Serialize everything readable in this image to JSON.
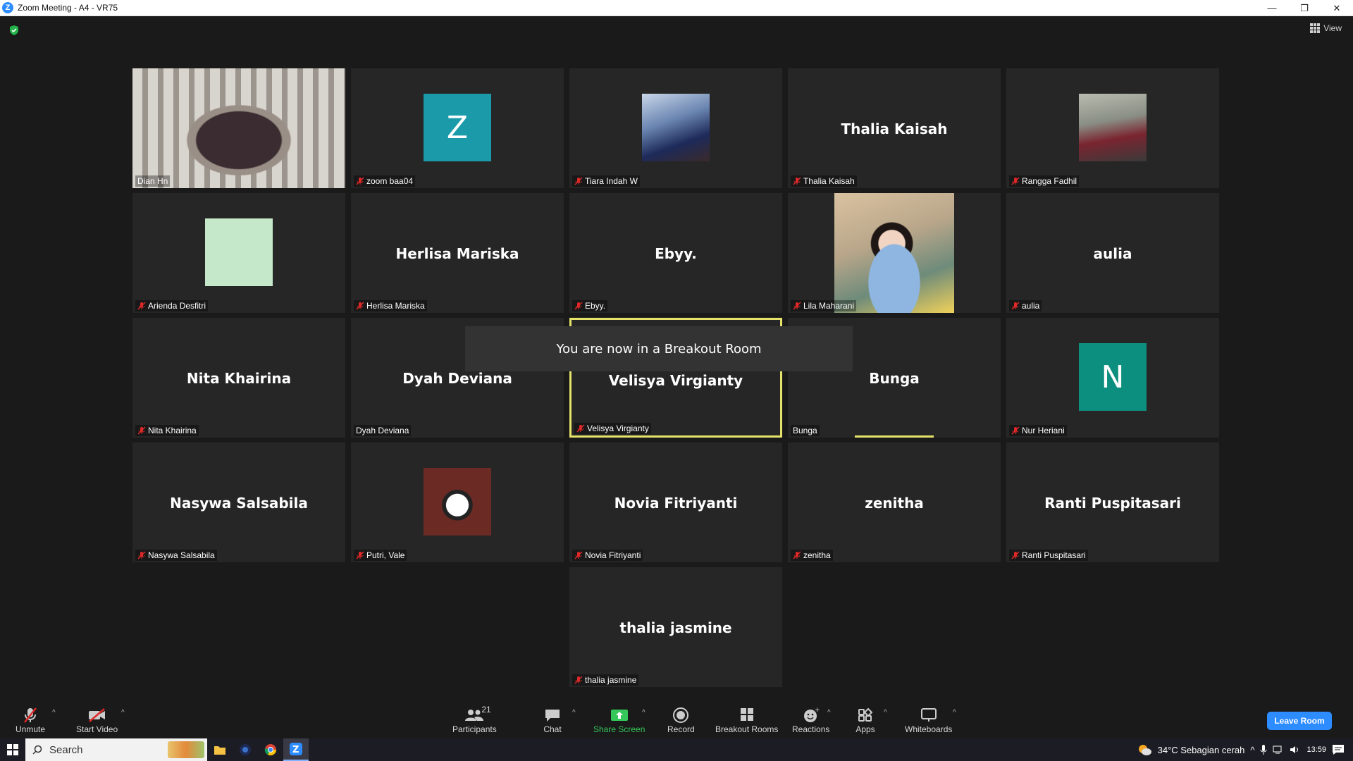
{
  "window": {
    "title": "Zoom Meeting - A4 - VR75"
  },
  "header": {
    "view_label": "View"
  },
  "participants_tiles": [
    {
      "name": "Dian Hn",
      "big": "",
      "muted": false,
      "kind": "video"
    },
    {
      "name": "zoom baa04",
      "big": "",
      "muted": true,
      "kind": "letter",
      "letter": "Z",
      "color": "#1b9aaa"
    },
    {
      "name": "Tiara Indah W",
      "big": "",
      "muted": true,
      "kind": "photo"
    },
    {
      "name": "Thalia Kaisah",
      "big": "Thalia Kaisah",
      "muted": true,
      "kind": "name"
    },
    {
      "name": "Rangga Fadhil",
      "big": "",
      "muted": true,
      "kind": "photo"
    },
    {
      "name": "Arienda Desfitri",
      "big": "",
      "muted": true,
      "kind": "solid",
      "color": "#c4e8c9"
    },
    {
      "name": "Herlisa Mariska",
      "big": "Herlisa Mariska",
      "muted": true,
      "kind": "name"
    },
    {
      "name": "Ebyy.",
      "big": "Ebyy.",
      "muted": true,
      "kind": "name"
    },
    {
      "name": "Lila Maharani",
      "big": "",
      "muted": true,
      "kind": "video"
    },
    {
      "name": "aulia",
      "big": "aulia",
      "muted": true,
      "kind": "name"
    },
    {
      "name": "Nita Khairina",
      "big": "Nita Khairina",
      "muted": true,
      "kind": "name"
    },
    {
      "name": "Dyah Deviana",
      "big": "Dyah Deviana",
      "muted": false,
      "kind": "name"
    },
    {
      "name": "Velisya Virgianty",
      "big": "Velisya Virgianty",
      "muted": true,
      "kind": "name"
    },
    {
      "name": "Bunga",
      "big": "Bunga",
      "muted": false,
      "kind": "name"
    },
    {
      "name": "Nur Heriani",
      "big": "",
      "muted": true,
      "kind": "letter",
      "letter": "N",
      "color": "#0d8f7f"
    },
    {
      "name": "Nasywa Salsabila",
      "big": "Nasywa Salsabila",
      "muted": true,
      "kind": "name"
    },
    {
      "name": "Putri, Vale",
      "big": "",
      "muted": true,
      "kind": "photo"
    },
    {
      "name": "Novia Fitriyanti",
      "big": "Novia Fitriyanti",
      "muted": true,
      "kind": "name"
    },
    {
      "name": "zenitha",
      "big": "zenitha",
      "muted": true,
      "kind": "name"
    },
    {
      "name": "Ranti Puspitasari",
      "big": "Ranti Puspitasari",
      "muted": true,
      "kind": "name"
    },
    {
      "name": "thalia jasmine",
      "big": "thalia jasmine",
      "muted": true,
      "kind": "name"
    }
  ],
  "toast": {
    "text": "You are now in a Breakout Room"
  },
  "toolbar": {
    "unmute": "Unmute",
    "start_video": "Start Video",
    "participants": "Participants",
    "participants_count": "21",
    "chat": "Chat",
    "share_screen": "Share Screen",
    "record": "Record",
    "breakout_rooms": "Breakout Rooms",
    "reactions": "Reactions",
    "apps": "Apps",
    "whiteboards": "Whiteboards",
    "leave_room": "Leave Room"
  },
  "taskbar": {
    "search_label": "Search",
    "weather": "34°C  Sebagian cerah",
    "time": "13:59"
  },
  "colors": {
    "accent": "#2d8cff",
    "active_border": "#e6e36b",
    "share_green": "#35c759",
    "mute_red": "#e02828"
  }
}
